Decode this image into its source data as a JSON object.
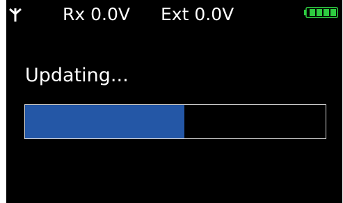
{
  "status_bar": {
    "antenna_icon": "antenna-icon",
    "rx_voltage": "Rx 0.0V",
    "ext_voltage": "Ext 0.0V",
    "battery_icon": "battery-icon",
    "battery_level": 1.0,
    "battery_color": "#2ecc40"
  },
  "main": {
    "message": "Updating...",
    "progress": 0.53,
    "progress_color": "#2457a6"
  },
  "colors": {
    "background": "#000000",
    "text": "#ffffff"
  }
}
